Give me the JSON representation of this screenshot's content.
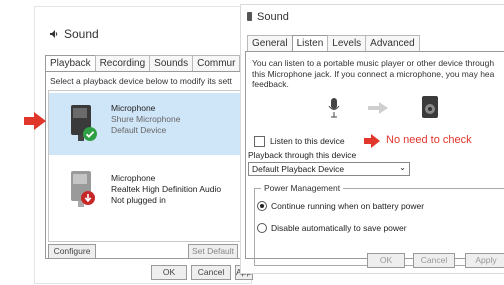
{
  "left_window": {
    "title": "Sound",
    "tabs": [
      "Playback",
      "Recording",
      "Sounds",
      "Commur"
    ],
    "instruction": "Select a playback device below to modify its sett",
    "devices": [
      {
        "name": "Microphone",
        "line2": "Shure Microphone",
        "line3": "Default Device",
        "status": "default",
        "selected": true
      },
      {
        "name": "Microphone",
        "line2": "Realtek High Definition Audio",
        "line3": "Not plugged in",
        "status": "unplugged",
        "selected": false
      }
    ],
    "configure_label": "Configure",
    "set_default_label": "Set Default",
    "ok_label": "OK",
    "cancel_label": "Cancel",
    "apply_label": "Apply"
  },
  "right_window": {
    "title": "Sound",
    "tabs": [
      "General",
      "Listen",
      "Levels",
      "Advanced"
    ],
    "description": "You can listen to a portable music player or other device through this Microphone jack. If you connect a microphone, you may hea feedback.",
    "listen_checkbox_label": "Listen to this device",
    "listen_checked": false,
    "annotation": "No need to check",
    "playback_through_label": "Playback through this device",
    "playback_device_value": "Default Playback Device",
    "power_group_label": "Power Management",
    "power_options": [
      {
        "label": "Continue running when on battery power",
        "selected": true
      },
      {
        "label": "Disable automatically to save power",
        "selected": false
      }
    ],
    "ok_label": "OK",
    "cancel_label": "Cancel",
    "apply_label": "Apply"
  },
  "colors": {
    "accent_red": "#e0362c",
    "selection_blue": "#cfe5f8",
    "check_green": "#2ea043"
  }
}
